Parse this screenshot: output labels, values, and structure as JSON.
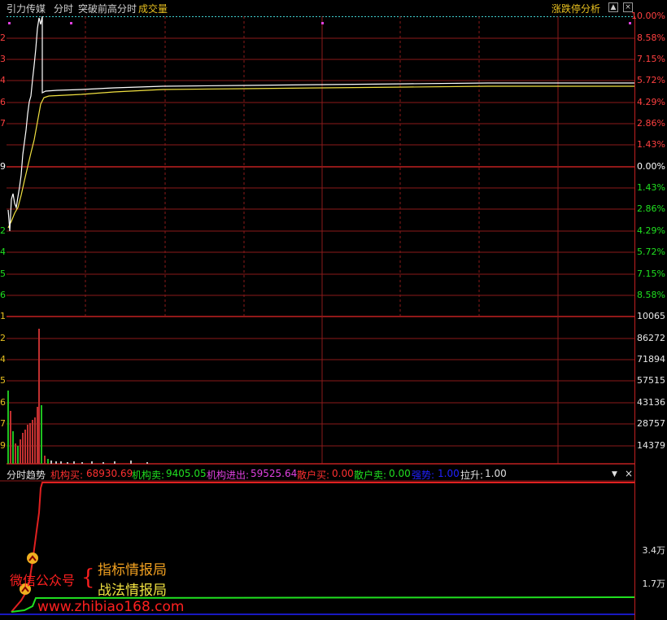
{
  "header": {
    "stock_name": "引力传媒",
    "mode": "分时",
    "indicator": "突破前高分时",
    "volume_label": "成交量",
    "right_tool": "涨跌停分析",
    "btn_up": "▲",
    "btn_close": "×"
  },
  "price_axis": {
    "right_labels": [
      "10.00%",
      "8.58%",
      "7.15%",
      "5.72%",
      "4.29%",
      "2.86%",
      "1.43%",
      "0.00%",
      "1.43%",
      "2.86%",
      "4.29%",
      "5.72%",
      "7.15%",
      "8.58%"
    ],
    "left_labels": [
      "3",
      "2",
      "4",
      "6",
      "7",
      "9",
      "1",
      "2",
      "4",
      "5",
      "6"
    ]
  },
  "volume_axis": {
    "right_labels": [
      "10065",
      "86272",
      "71894",
      "57515",
      "43136",
      "28757",
      "14379"
    ],
    "left_labels": [
      "1",
      "2",
      "4",
      "5",
      "6",
      "7",
      "9"
    ]
  },
  "sub_panel": {
    "title": "分时趋势",
    "items": [
      {
        "label": "机构买:",
        "value": "68930.69",
        "color": "#ff3030"
      },
      {
        "label": "机构卖:",
        "value": "9405.05",
        "color": "#20e020"
      },
      {
        "label": "机构进出:",
        "value": "59525.64",
        "color": "#e040e0"
      },
      {
        "label": "散户买:",
        "value": "0.00",
        "color": "#ff3030"
      },
      {
        "label": "散户卖:",
        "value": "0.00",
        "color": "#20e020"
      },
      {
        "label": "强势:",
        "value": "1.00",
        "color": "#2020ff"
      },
      {
        "label": "拉升:",
        "value": "1.00",
        "color": "#e0e0e0"
      }
    ],
    "axis_labels": [
      "3.4万",
      "1.7万"
    ],
    "dropdown": "▼",
    "close": "×"
  },
  "watermark": {
    "wechat": "微信公众号",
    "brace": "{",
    "line1": "指标情报局",
    "line2": "战法情报局",
    "url": "www.zhibiao168.com"
  }
}
